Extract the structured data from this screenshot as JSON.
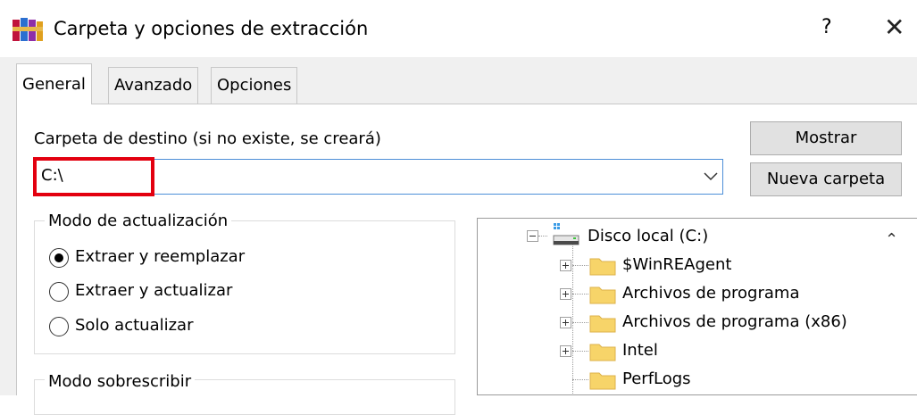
{
  "window": {
    "title": "Carpeta y opciones de extracción",
    "help_label": "?",
    "close_label": "✕",
    "icon": "winrar-books-icon"
  },
  "tabs": [
    {
      "label": "General",
      "selected": true
    },
    {
      "label": "Avanzado",
      "selected": false
    },
    {
      "label": "Opciones",
      "selected": false
    }
  ],
  "destination": {
    "label": "Carpeta de destino (si no existe, se creará)",
    "value": "C:\\",
    "highlight_color": "#e3000f"
  },
  "buttons": {
    "show_label": "Mostrar",
    "new_folder_label": "Nueva carpeta"
  },
  "update_mode": {
    "title": "Modo de actualización",
    "options": [
      {
        "label": "Extraer y reemplazar",
        "checked": true
      },
      {
        "label": "Extraer y actualizar",
        "checked": false
      },
      {
        "label": "Solo actualizar",
        "checked": false
      }
    ]
  },
  "overwrite_mode": {
    "title": "Modo sobrescribir"
  },
  "tree": {
    "root": "Disco local (C:)",
    "items": [
      "$WinREAgent",
      "Archivos de programa",
      "Archivos de programa (x86)",
      "Intel",
      "PerfLogs"
    ]
  }
}
